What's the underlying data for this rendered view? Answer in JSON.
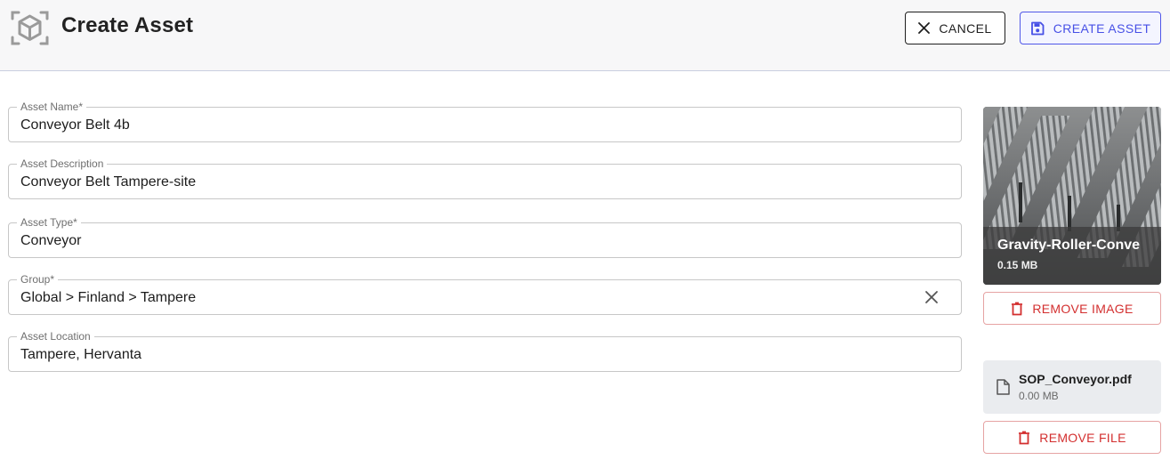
{
  "header": {
    "title": "Create Asset",
    "cancel_label": "CANCEL",
    "create_label": "CREATE ASSET"
  },
  "form": {
    "fields": [
      {
        "label": "Asset Name*",
        "value": "Conveyor Belt 4b"
      },
      {
        "label": "Asset Description",
        "value": "Conveyor Belt Tampere-site"
      },
      {
        "label": "Asset Type*",
        "value": "Conveyor"
      },
      {
        "label": "Group*",
        "value": "Global > Finland > Tampere"
      },
      {
        "label": "Asset Location",
        "value": "Tampere, Hervanta"
      }
    ]
  },
  "image": {
    "name": "Gravity-Roller-Conve",
    "size": "0.15 MB",
    "remove_label": "REMOVE IMAGE"
  },
  "file": {
    "name": "SOP_Conveyor.pdf",
    "size": "0.00 MB",
    "remove_label": "REMOVE FILE"
  },
  "colors": {
    "accent": "#4750e6",
    "danger": "#d32f2f"
  }
}
